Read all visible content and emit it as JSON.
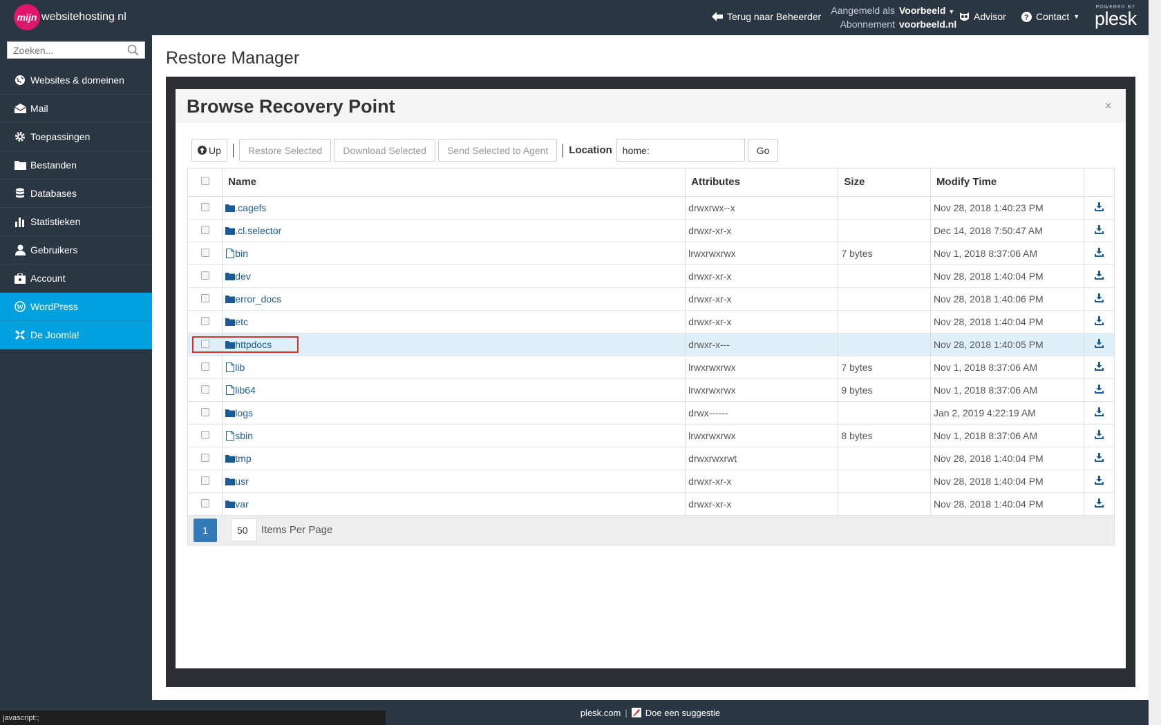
{
  "topbar": {
    "logo_mark": "mijn",
    "logo_name": "websitehosting",
    "logo_dot": ".",
    "logo_tld": "nl",
    "back_label": "Terug naar Beheerder",
    "logged_in_label": "Aangemeld als",
    "logged_in_value": "Voorbeeld",
    "subscription_label": "Abonnement",
    "subscription_value": "voorbeeld.nl",
    "advisor_label": "Advisor",
    "contact_label": "Contact",
    "powered_by": "POWERED BY",
    "brand": "plesk"
  },
  "sidebar": {
    "search_placeholder": "Zoeken...",
    "items": [
      {
        "label": "Websites & domeinen",
        "icon": "globe-icon"
      },
      {
        "label": "Mail",
        "icon": "mail-icon"
      },
      {
        "label": "Toepassingen",
        "icon": "gear-icon"
      },
      {
        "label": "Bestanden",
        "icon": "folder-icon"
      },
      {
        "label": "Databases",
        "icon": "database-icon"
      },
      {
        "label": "Statistieken",
        "icon": "bar-chart-icon"
      },
      {
        "label": "Gebruikers",
        "icon": "user-icon"
      },
      {
        "label": "Account",
        "icon": "account-icon"
      },
      {
        "label": "WordPress",
        "icon": "wordpress-icon"
      },
      {
        "label": "De Joomla!",
        "icon": "joomla-icon"
      }
    ]
  },
  "page": {
    "title": "Restore Manager"
  },
  "modal": {
    "title": "Browse Recovery Point",
    "close": "×",
    "toolbar": {
      "up": "Up",
      "restore": "Restore Selected",
      "download": "Download Selected",
      "send": "Send Selected to Agent",
      "location_label": "Location",
      "location_value": "home:",
      "go": "Go"
    },
    "columns": [
      "Name",
      "Attributes",
      "Size",
      "Modify Time"
    ],
    "rows": [
      {
        "type": "folder",
        "name": ".cagefs",
        "attributes": "drwxrwx--x",
        "size": "",
        "modified": "Nov 28, 2018 1:40:23 PM"
      },
      {
        "type": "folder",
        "name": ".cl.selector",
        "attributes": "drwxr-xr-x",
        "size": "",
        "modified": "Dec 14, 2018 7:50:47 AM"
      },
      {
        "type": "file",
        "name": "bin",
        "attributes": "lrwxrwxrwx",
        "size": "7 bytes",
        "modified": "Nov 1, 2018 8:37:06 AM"
      },
      {
        "type": "folder",
        "name": "dev",
        "attributes": "drwxr-xr-x",
        "size": "",
        "modified": "Nov 28, 2018 1:40:04 PM"
      },
      {
        "type": "folder",
        "name": "error_docs",
        "attributes": "drwxr-xr-x",
        "size": "",
        "modified": "Nov 28, 2018 1:40:06 PM"
      },
      {
        "type": "folder",
        "name": "etc",
        "attributes": "drwxr-xr-x",
        "size": "",
        "modified": "Nov 28, 2018 1:40:04 PM"
      },
      {
        "type": "folder",
        "name": "httpdocs",
        "attributes": "drwxr-x---",
        "size": "",
        "modified": "Nov 28, 2018 1:40:05 PM",
        "selected": true
      },
      {
        "type": "file",
        "name": "lib",
        "attributes": "lrwxrwxrwx",
        "size": "7 bytes",
        "modified": "Nov 1, 2018 8:37:06 AM"
      },
      {
        "type": "file",
        "name": "lib64",
        "attributes": "lrwxrwxrwx",
        "size": "9 bytes",
        "modified": "Nov 1, 2018 8:37:06 AM"
      },
      {
        "type": "folder",
        "name": "logs",
        "attributes": "drwx------",
        "size": "",
        "modified": "Jan 2, 2019 4:22:19 AM"
      },
      {
        "type": "file",
        "name": "sbin",
        "attributes": "lrwxrwxrwx",
        "size": "8 bytes",
        "modified": "Nov 1, 2018 8:37:06 AM"
      },
      {
        "type": "folder",
        "name": "tmp",
        "attributes": "drwxrwxrwt",
        "size": "",
        "modified": "Nov 28, 2018 1:40:04 PM"
      },
      {
        "type": "folder",
        "name": "usr",
        "attributes": "drwxr-xr-x",
        "size": "",
        "modified": "Nov 28, 2018 1:40:04 PM"
      },
      {
        "type": "folder",
        "name": "var",
        "attributes": "drwxr-xr-x",
        "size": "",
        "modified": "Nov 28, 2018 1:40:04 PM"
      }
    ],
    "pagination": {
      "current_page": "1",
      "per_page": "50",
      "per_page_label": "Items Per Page"
    }
  },
  "footer": {
    "link": "plesk.com",
    "separator": "|",
    "suggestion": "Doe een suggestie"
  },
  "statusbar": {
    "text": "javascript:;"
  },
  "colors": {
    "topbar": "#2b3643",
    "accent": "#00a1de",
    "link": "#1a5b96",
    "highlight_box": "#d9302c"
  }
}
